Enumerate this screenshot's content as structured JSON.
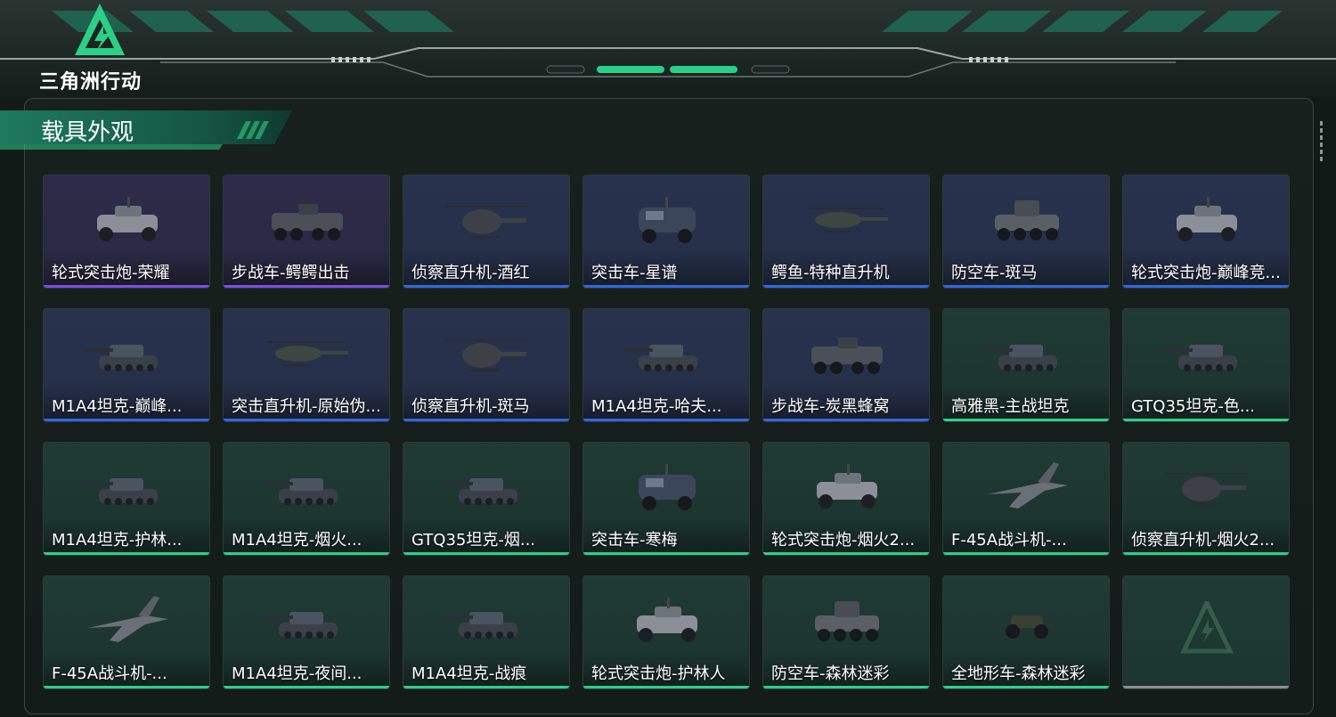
{
  "app": {
    "logo_text": "三角洲行动"
  },
  "section": {
    "title": "载具外观"
  },
  "colors": {
    "purple": "#7a4fe0",
    "blue": "#2f68e0",
    "green": "#2ccf86",
    "accent": "#2ccf86"
  },
  "items": [
    {
      "label": "轮式突击炮-荣耀",
      "rarity": "purple",
      "icon": "wheeled-assault-gun"
    },
    {
      "label": "步战车-鳄鳄出击",
      "rarity": "purple",
      "icon": "infantry-fighting-vehicle"
    },
    {
      "label": "侦察直升机-酒红",
      "rarity": "blue",
      "icon": "scout-helicopter"
    },
    {
      "label": "突击车-星谱",
      "rarity": "blue",
      "icon": "assault-vehicle"
    },
    {
      "label": "鳄鱼-特种直升机",
      "rarity": "blue",
      "icon": "attack-helicopter"
    },
    {
      "label": "防空车-斑马",
      "rarity": "blue",
      "icon": "anti-air-vehicle"
    },
    {
      "label": "轮式突击炮-巅峰竞...",
      "rarity": "blue",
      "icon": "wheeled-assault-gun"
    },
    {
      "label": "M1A4坦克-巅峰...",
      "rarity": "blue",
      "icon": "tank"
    },
    {
      "label": "突击直升机-原始伪...",
      "rarity": "blue",
      "icon": "attack-helicopter"
    },
    {
      "label": "侦察直升机-斑马",
      "rarity": "blue",
      "icon": "scout-helicopter"
    },
    {
      "label": "M1A4坦克-哈夫...",
      "rarity": "blue",
      "icon": "tank"
    },
    {
      "label": "步战车-炭黑蜂窝",
      "rarity": "blue",
      "icon": "infantry-fighting-vehicle"
    },
    {
      "label": "高雅黑-主战坦克",
      "rarity": "green",
      "icon": "tank"
    },
    {
      "label": "GTQ35坦克-色...",
      "rarity": "green",
      "icon": "tank"
    },
    {
      "label": "M1A4坦克-护林...",
      "rarity": "green",
      "icon": "tank"
    },
    {
      "label": "M1A4坦克-烟火...",
      "rarity": "green",
      "icon": "tank"
    },
    {
      "label": "GTQ35坦克-烟...",
      "rarity": "green",
      "icon": "tank"
    },
    {
      "label": "突击车-寒梅",
      "rarity": "green",
      "icon": "assault-vehicle"
    },
    {
      "label": "轮式突击炮-烟火2...",
      "rarity": "green",
      "icon": "wheeled-assault-gun"
    },
    {
      "label": "F-45A战斗机-...",
      "rarity": "green",
      "icon": "fighter-jet"
    },
    {
      "label": "侦察直升机-烟火2...",
      "rarity": "green",
      "icon": "scout-helicopter"
    },
    {
      "label": "F-45A战斗机-...",
      "rarity": "green",
      "icon": "fighter-jet"
    },
    {
      "label": "M1A4坦克-夜间...",
      "rarity": "green",
      "icon": "tank"
    },
    {
      "label": "M1A4坦克-战痕",
      "rarity": "green",
      "icon": "tank"
    },
    {
      "label": "轮式突击炮-护林人",
      "rarity": "green",
      "icon": "wheeled-assault-gun"
    },
    {
      "label": "防空车-森林迷彩",
      "rarity": "green",
      "icon": "anti-air-vehicle"
    },
    {
      "label": "全地形车-森林迷彩",
      "rarity": "green",
      "icon": "atv"
    },
    {
      "label": "",
      "rarity": "empty",
      "icon": "empty-slot"
    }
  ]
}
